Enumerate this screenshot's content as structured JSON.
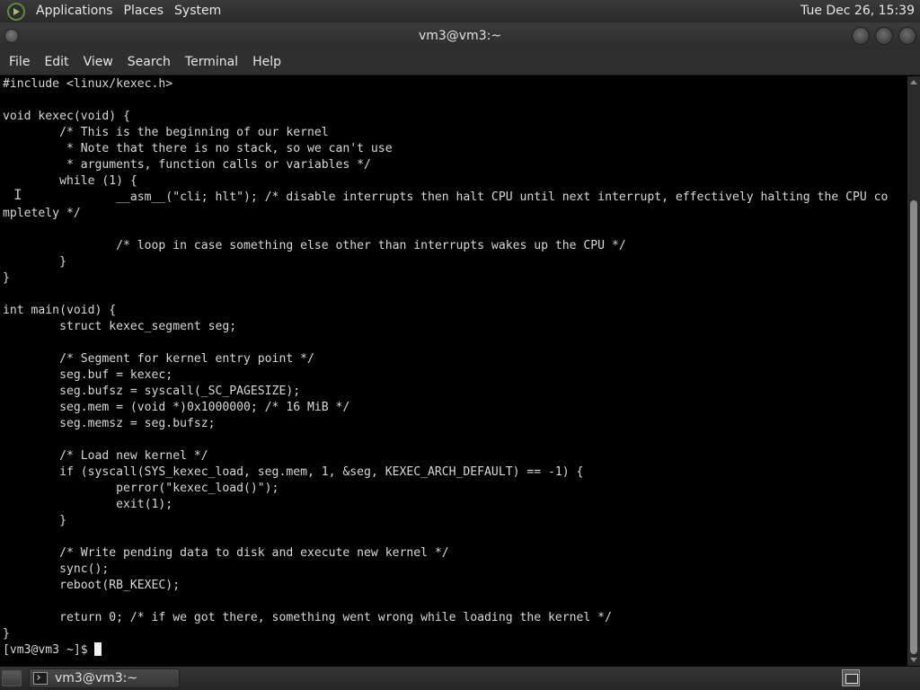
{
  "top_panel": {
    "menus": [
      "Applications",
      "Places",
      "System"
    ],
    "clock": "Tue Dec 26, 15:39"
  },
  "window": {
    "title": "vm3@vm3:~"
  },
  "menubar": {
    "items": [
      "File",
      "Edit",
      "View",
      "Search",
      "Terminal",
      "Help"
    ]
  },
  "terminal": {
    "lines": [
      "#include <linux/kexec.h>",
      "",
      "void kexec(void) {",
      "        /* This is the beginning of our kernel",
      "         * Note that there is no stack, so we can't use",
      "         * arguments, function calls or variables */",
      "        while (1) {",
      "                __asm__(\"cli; hlt\"); /* disable interrupts then halt CPU until next interrupt, effectively halting the CPU co",
      "mpletely */",
      "",
      "                /* loop in case something else other than interrupts wakes up the CPU */",
      "        }",
      "}",
      "",
      "int main(void) {",
      "        struct kexec_segment seg;",
      "",
      "        /* Segment for kernel entry point */",
      "        seg.buf = kexec;",
      "        seg.bufsz = syscall(_SC_PAGESIZE);",
      "        seg.mem = (void *)0x1000000; /* 16 MiB */",
      "        seg.memsz = seg.bufsz;",
      "",
      "        /* Load new kernel */",
      "        if (syscall(SYS_kexec_load, seg.mem, 1, &seg, KEXEC_ARCH_DEFAULT) == -1) {",
      "                perror(\"kexec_load()\");",
      "                exit(1);",
      "        }",
      "",
      "        /* Write pending data to disk and execute new kernel */",
      "        sync();",
      "        reboot(RB_KEXEC);",
      "",
      "        return 0; /* if we got there, something went wrong while loading the kernel */",
      "}"
    ],
    "prompt": "[vm3@vm3 ~]$ "
  },
  "taskbar": {
    "task_label": "vm3@vm3:~"
  },
  "icons": {
    "logo": "gnome-foot-icon",
    "terminal": "terminal-icon",
    "workspace": "workspace-switcher-icon"
  },
  "colors": {
    "terminal_bg": "#000000",
    "terminal_fg": "#d8d8d8",
    "panel_bg": "#2f2f2f"
  }
}
